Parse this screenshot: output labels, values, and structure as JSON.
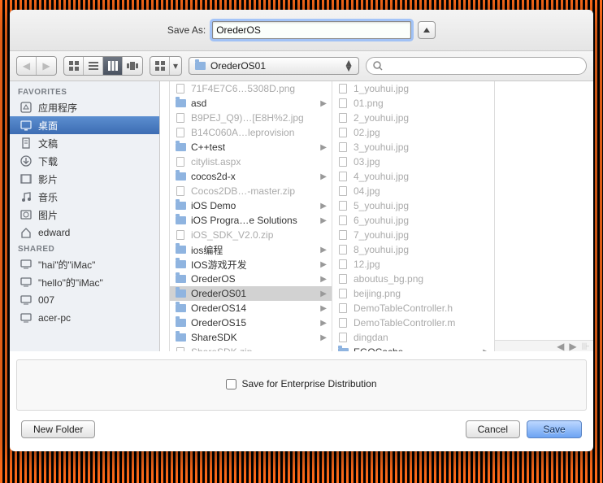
{
  "saveas": {
    "label": "Save As:",
    "value": "OrederOS"
  },
  "path_current": "OrederOS01",
  "search": {
    "placeholder": ""
  },
  "sidebar": {
    "sections": [
      {
        "header": "FAVORITES",
        "items": [
          {
            "icon": "app",
            "label": "应用程序"
          },
          {
            "icon": "desktop",
            "label": "桌面",
            "selected": true
          },
          {
            "icon": "docs",
            "label": "文稿"
          },
          {
            "icon": "download",
            "label": "下载"
          },
          {
            "icon": "movies",
            "label": "影片"
          },
          {
            "icon": "music",
            "label": "音乐"
          },
          {
            "icon": "pictures",
            "label": "图片"
          },
          {
            "icon": "home",
            "label": "edward"
          }
        ]
      },
      {
        "header": "SHARED",
        "items": [
          {
            "icon": "computer",
            "label": "\"hai\"的\"iMac\""
          },
          {
            "icon": "computer",
            "label": "\"hello\"的\"iMac\""
          },
          {
            "icon": "computer",
            "label": "007"
          },
          {
            "icon": "computer",
            "label": "acer-pc"
          }
        ]
      }
    ]
  },
  "col1": [
    {
      "t": "file",
      "dim": true,
      "n": "71F4E7C6…5308D.png"
    },
    {
      "t": "folder",
      "n": "asd",
      "ch": true
    },
    {
      "t": "file",
      "dim": true,
      "n": "B9PEJ_Q9)…[E8H%2.jpg"
    },
    {
      "t": "file",
      "dim": true,
      "n": "B14C060A…leprovision"
    },
    {
      "t": "folder",
      "n": "C++test",
      "ch": true
    },
    {
      "t": "file",
      "dim": true,
      "n": "citylist.aspx"
    },
    {
      "t": "folder",
      "n": "cocos2d-x",
      "ch": true
    },
    {
      "t": "file",
      "dim": true,
      "n": "Cocos2DB…-master.zip"
    },
    {
      "t": "folder",
      "n": "iOS Demo",
      "ch": true
    },
    {
      "t": "folder",
      "n": "iOS Progra…e Solutions",
      "ch": true
    },
    {
      "t": "file",
      "dim": true,
      "n": "iOS_SDK_V2.0.zip"
    },
    {
      "t": "folder",
      "n": "ios编程",
      "ch": true
    },
    {
      "t": "folder",
      "n": "IOS游戏开发",
      "ch": true
    },
    {
      "t": "folder",
      "n": "OrederOS",
      "ch": true
    },
    {
      "t": "folder",
      "n": "OrederOS01",
      "ch": true,
      "sel": true
    },
    {
      "t": "folder",
      "n": "OrederOS14",
      "ch": true
    },
    {
      "t": "folder",
      "n": "OrederOS15",
      "ch": true
    },
    {
      "t": "folder",
      "n": "ShareSDK",
      "ch": true
    },
    {
      "t": "file",
      "dim": true,
      "n": "ShareSDK.zip"
    }
  ],
  "col2": [
    {
      "t": "file",
      "dim": true,
      "n": "1_youhui.jpg"
    },
    {
      "t": "file",
      "dim": true,
      "n": "01.png"
    },
    {
      "t": "file",
      "dim": true,
      "n": "2_youhui.jpg"
    },
    {
      "t": "file",
      "dim": true,
      "n": "02.jpg"
    },
    {
      "t": "file",
      "dim": true,
      "n": "3_youhui.jpg"
    },
    {
      "t": "file",
      "dim": true,
      "n": "03.jpg"
    },
    {
      "t": "file",
      "dim": true,
      "n": "4_youhui.jpg"
    },
    {
      "t": "file",
      "dim": true,
      "n": "04.jpg"
    },
    {
      "t": "file",
      "dim": true,
      "n": "5_youhui.jpg"
    },
    {
      "t": "file",
      "dim": true,
      "n": "6_youhui.jpg"
    },
    {
      "t": "file",
      "dim": true,
      "n": "7_youhui.jpg"
    },
    {
      "t": "file",
      "dim": true,
      "n": "8_youhui.jpg"
    },
    {
      "t": "file",
      "dim": true,
      "n": "12.jpg"
    },
    {
      "t": "file",
      "dim": true,
      "n": "aboutus_bg.png"
    },
    {
      "t": "file",
      "dim": true,
      "n": "beijing.png"
    },
    {
      "t": "file",
      "dim": true,
      "n": "DemoTableController.h"
    },
    {
      "t": "file",
      "dim": true,
      "n": "DemoTableController.m"
    },
    {
      "t": "file",
      "dim": true,
      "n": "dingdan"
    },
    {
      "t": "folder",
      "n": "EGOCache",
      "ch": true
    }
  ],
  "option_label": "Save for Enterprise Distribution",
  "buttons": {
    "newfolder": "New Folder",
    "cancel": "Cancel",
    "save": "Save"
  }
}
